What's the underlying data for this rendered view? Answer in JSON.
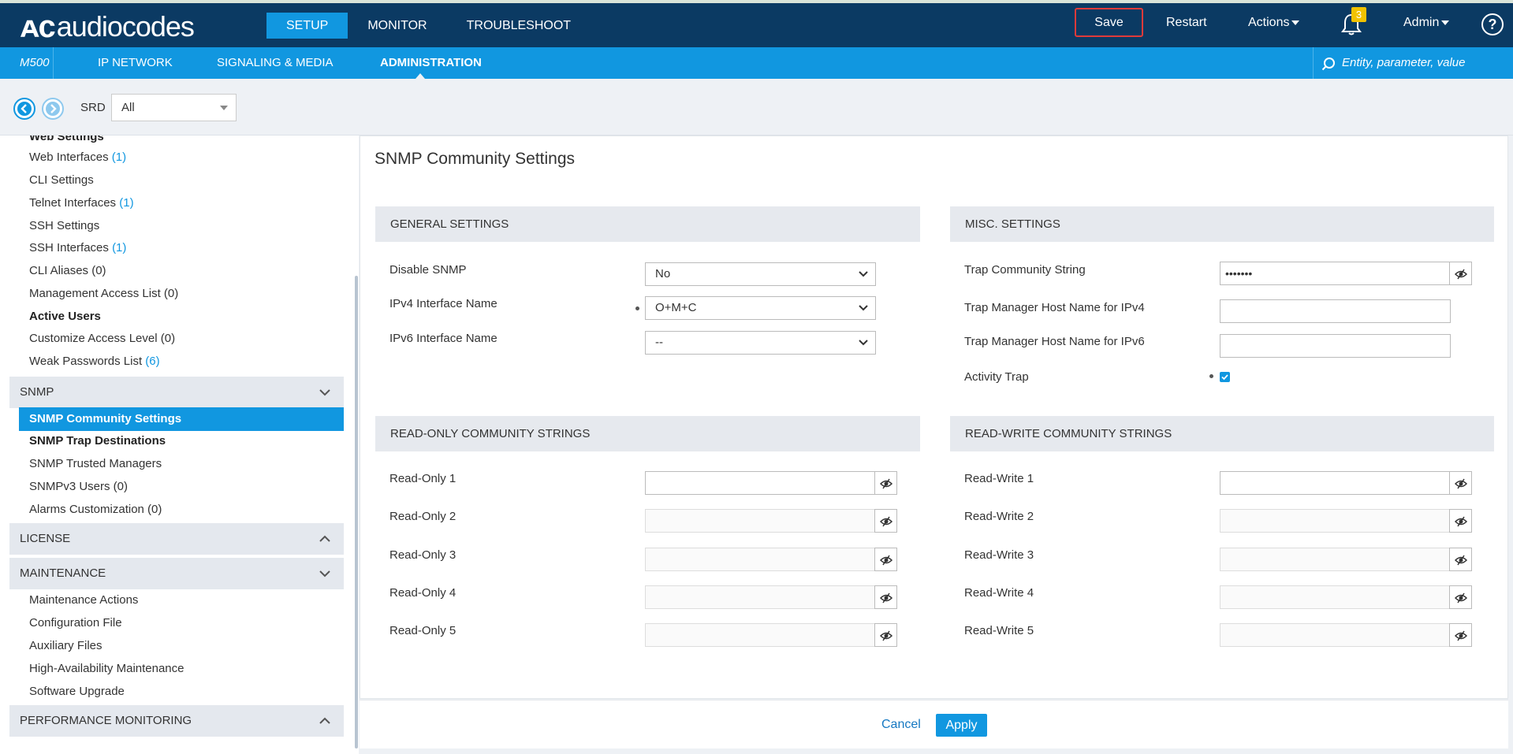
{
  "brand": {
    "logo_text": "audiocodes"
  },
  "top_nav": {
    "tabs": [
      "SETUP",
      "MONITOR",
      "TROUBLESHOOT"
    ]
  },
  "top_right": {
    "save": "Save",
    "restart": "Restart",
    "actions": "Actions",
    "notifications": "3",
    "admin": "Admin",
    "help": "?"
  },
  "sub_nav": {
    "device": "M500",
    "tabs": [
      "IP NETWORK",
      "SIGNALING & MEDIA",
      "ADMINISTRATION"
    ],
    "search_placeholder": "Entity, parameter, value"
  },
  "toolbar": {
    "srd_label": "SRD",
    "srd_value": "All"
  },
  "sidebar": {
    "items_top": [
      {
        "label": "Web Settings",
        "count": ""
      },
      {
        "label": "Web Interfaces",
        "count": "(1)"
      },
      {
        "label": "CLI Settings",
        "count": ""
      },
      {
        "label": "Telnet Interfaces",
        "count": "(1)"
      },
      {
        "label": "SSH Settings",
        "count": ""
      },
      {
        "label": "SSH Interfaces",
        "count": "(1)"
      },
      {
        "label": "CLI Aliases (0)",
        "count": ""
      },
      {
        "label": "Management Access List (0)",
        "count": ""
      },
      {
        "label": "Active Users",
        "count": ""
      },
      {
        "label": "Customize Access Level (0)",
        "count": ""
      },
      {
        "label": "Weak Passwords List",
        "count": "(6)"
      }
    ],
    "snmp_section": "SNMP",
    "snmp_items": [
      "SNMP Community Settings",
      "SNMP Trap Destinations",
      "SNMP Trusted Managers",
      "SNMPv3 Users (0)",
      "Alarms Customization (0)"
    ],
    "license_section": "LICENSE",
    "maintenance_section": "MAINTENANCE",
    "maintenance_items": [
      "Maintenance Actions",
      "Configuration File",
      "Auxiliary Files",
      "High-Availability Maintenance",
      "Software Upgrade"
    ],
    "perf_section": "PERFORMANCE MONITORING"
  },
  "page": {
    "title": "SNMP Community Settings"
  },
  "general": {
    "heading": "GENERAL SETTINGS",
    "disable_snmp_label": "Disable SNMP",
    "disable_snmp_value": "No",
    "ipv4_label": "IPv4 Interface Name",
    "ipv4_value": "O+M+C",
    "ipv6_label": "IPv6 Interface Name",
    "ipv6_value": "--"
  },
  "misc": {
    "heading": "MISC. SETTINGS",
    "trap_comm_label": "Trap Community String",
    "trap_comm_value": "•••••••",
    "trap_ipv4_label": "Trap Manager Host Name for IPv4",
    "trap_ipv4_value": "",
    "trap_ipv6_label": "Trap Manager Host Name for IPv6",
    "trap_ipv6_value": "",
    "activity_trap_label": "Activity Trap",
    "activity_trap_checked": true
  },
  "read_only": {
    "heading": "READ-ONLY COMMUNITY STRINGS",
    "labels": [
      "Read-Only 1",
      "Read-Only 2",
      "Read-Only 3",
      "Read-Only 4",
      "Read-Only 5"
    ]
  },
  "read_write": {
    "heading": "READ-WRITE COMMUNITY STRINGS",
    "labels": [
      "Read-Write 1",
      "Read-Write 2",
      "Read-Write 3",
      "Read-Write 4",
      "Read-Write 5"
    ]
  },
  "footer": {
    "cancel": "Cancel",
    "apply": "Apply"
  },
  "colors": {
    "topbar": "#0b3a63",
    "accent": "#1197e0",
    "save_border": "#e03a3a",
    "badge": "#f2c200"
  }
}
